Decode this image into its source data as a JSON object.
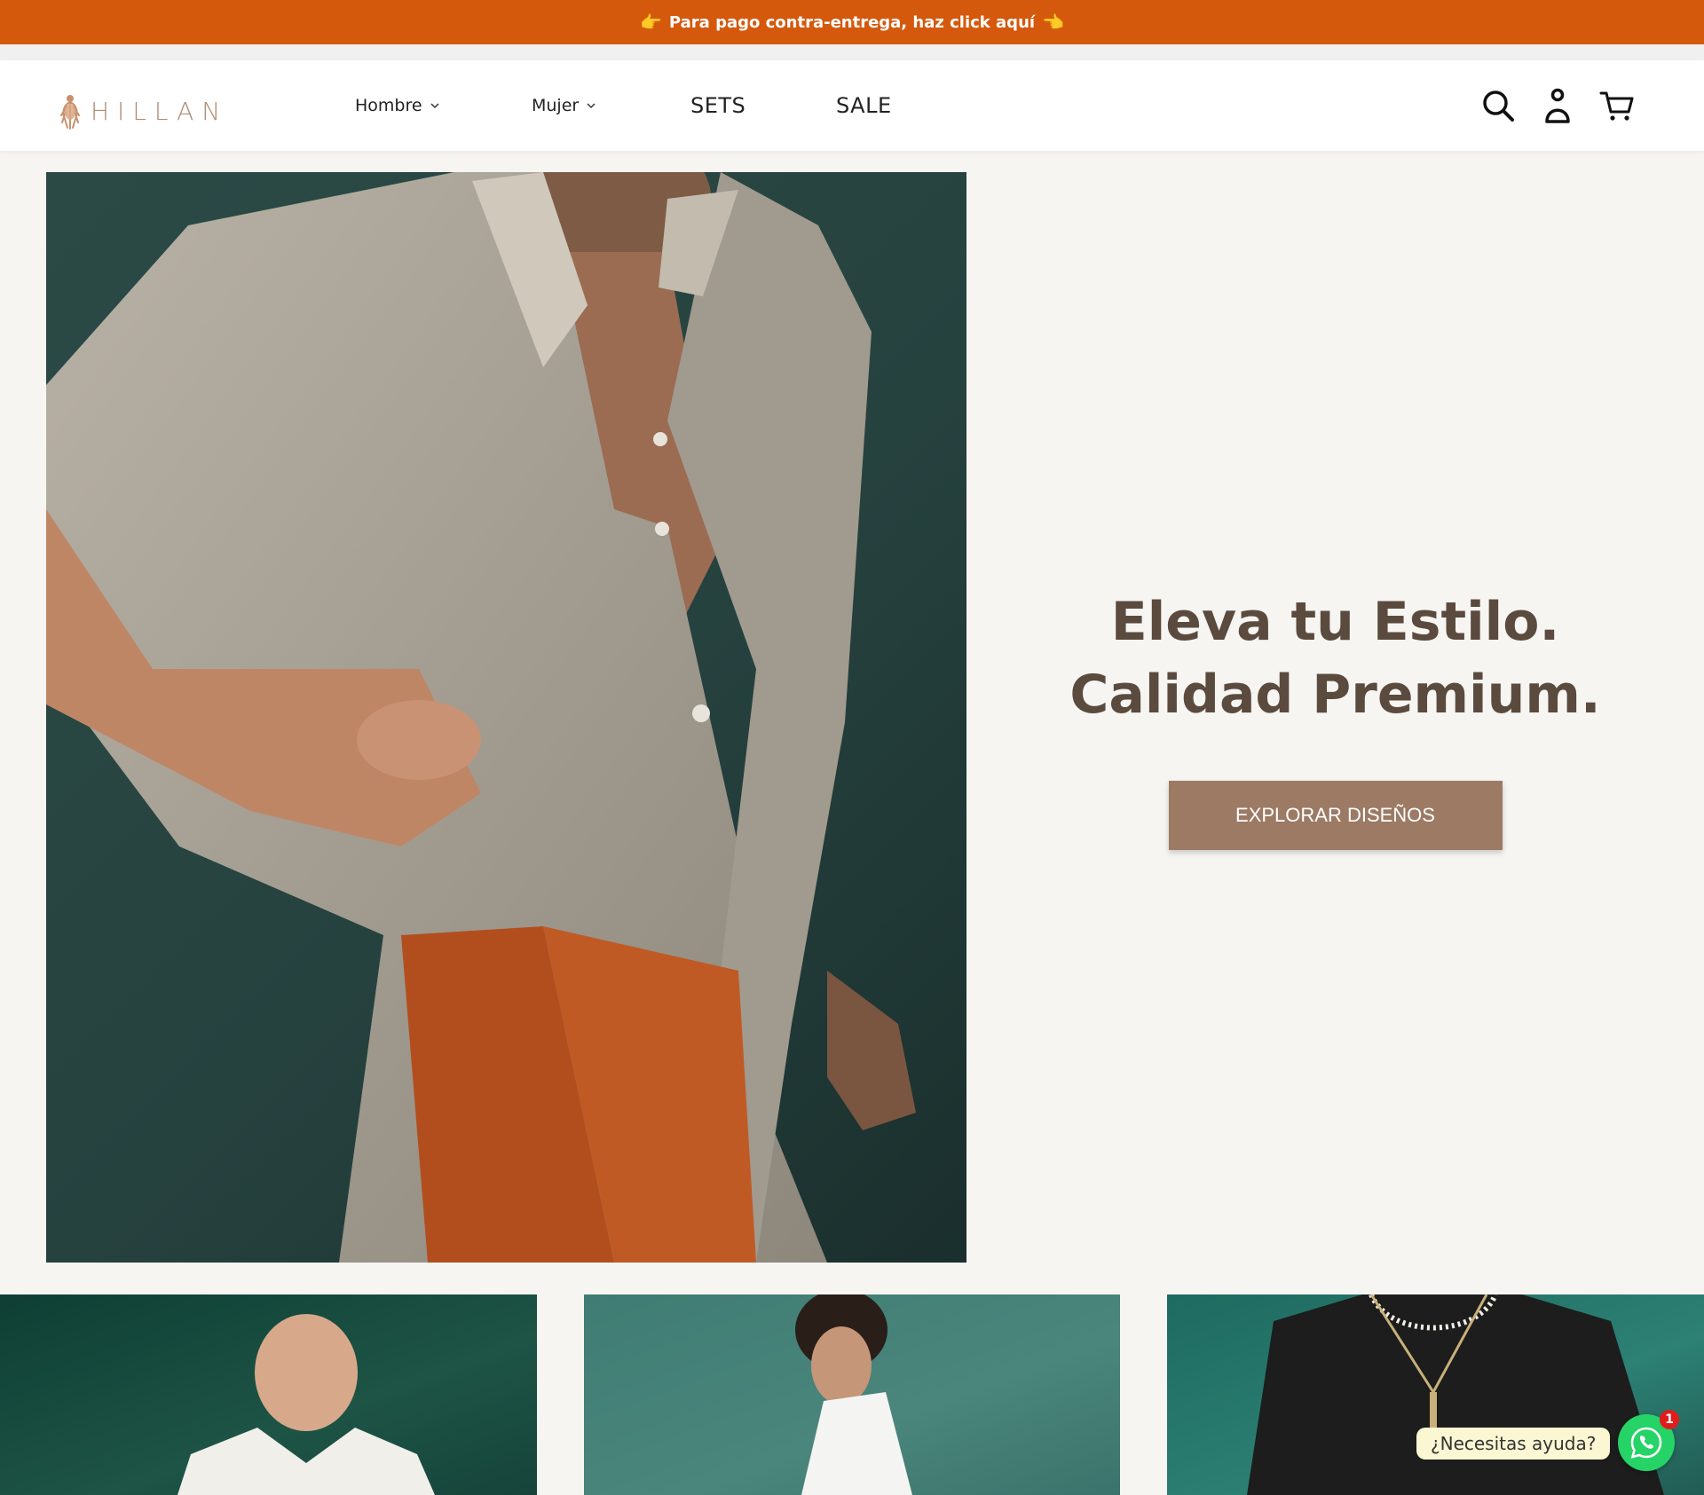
{
  "announcement": {
    "text": "Para pago contra-entrega, haz click aquí",
    "emoji_left": "👉",
    "emoji_right": "👈"
  },
  "brand": {
    "name": "HILLAN",
    "accent": "#b08d77"
  },
  "nav": {
    "items": [
      {
        "label": "Hombre",
        "has_dropdown": true
      },
      {
        "label": "Mujer",
        "has_dropdown": true
      },
      {
        "label": "SETS",
        "has_dropdown": false
      },
      {
        "label": "SALE",
        "has_dropdown": false
      }
    ],
    "icons": [
      "search-icon",
      "account-icon",
      "cart-icon"
    ]
  },
  "hero": {
    "title_line1": "Eleva tu Estilo.",
    "title_line2": "Calidad Premium.",
    "cta": "EXPLORAR DISEÑOS"
  },
  "whatsapp": {
    "bubble": "¿Necesitas ayuda?",
    "badge": "1"
  },
  "colors": {
    "announce_bg": "#d4590d",
    "page_bg": "#f6f5f2",
    "title": "#5b4a3e",
    "button": "#9c7a64",
    "whatsapp": "#25d366"
  }
}
